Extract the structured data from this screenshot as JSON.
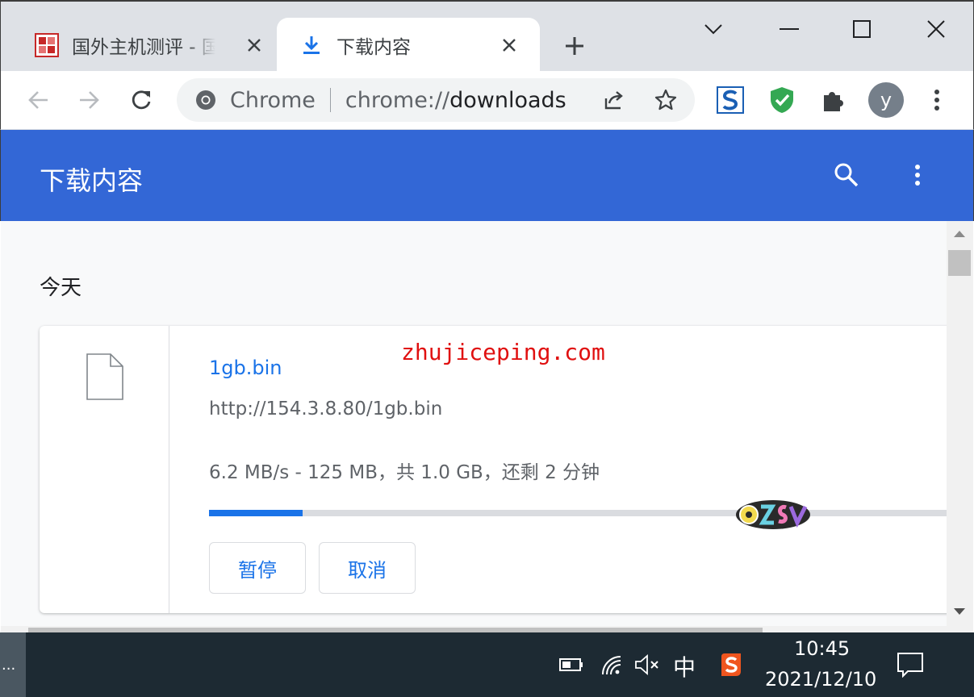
{
  "tabs": [
    {
      "title": "国外主机测评 - 国外VPS",
      "favicon": "site-red-seal-icon",
      "active": false
    },
    {
      "title": "下载内容",
      "favicon": "download-icon",
      "active": true
    }
  ],
  "window_controls": [
    "chevron-down-icon",
    "minimize-icon",
    "maximize-icon",
    "close-icon"
  ],
  "omnibox": {
    "chip": "Chrome",
    "url_scheme": "chrome://",
    "url_path": "downloads"
  },
  "avatar": {
    "initial": "y"
  },
  "header": {
    "title": "下载内容"
  },
  "section": {
    "date": "今天"
  },
  "download": {
    "file_name": "1gb.bin",
    "url": "http://154.3.8.80/1gb.bin",
    "status": "6.2 MB/s - 125 MB，共 1.0 GB，还剩 2 分钟",
    "progress_fraction": 0.125,
    "pause_label": "暂停",
    "cancel_label": "取消"
  },
  "watermark": {
    "text": "zhujiceping.com"
  },
  "taskbar": {
    "start_label": "...",
    "ime_label": "中",
    "time": "10:45",
    "date": "2021/12/10"
  },
  "colors": {
    "header_blue": "#3367d6",
    "link_blue": "#1a73e8",
    "tab_strip": "#dee1e6",
    "taskbar": "#1d2a33",
    "shield_green": "#34a853",
    "sogou_orange": "#f0551e"
  }
}
